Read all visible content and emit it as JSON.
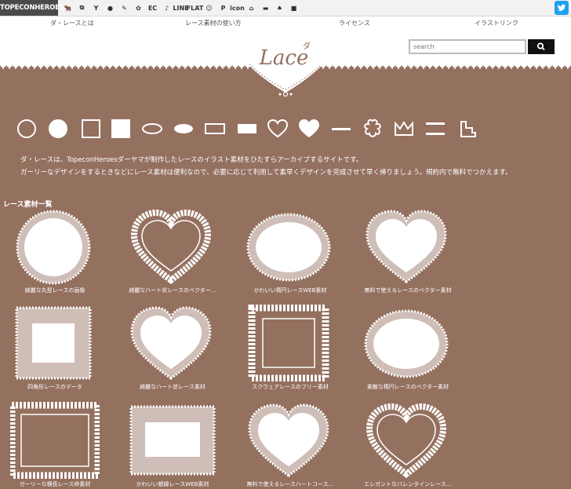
{
  "topbar": {
    "brand": "TOPECONHEROES",
    "icons": [
      {
        "name": "animal-icon",
        "glyph": "🐂"
      },
      {
        "name": "copy-icon",
        "glyph": "⧉"
      },
      {
        "name": "person-icon",
        "glyph": "Y"
      },
      {
        "name": "chat-icon",
        "glyph": "●"
      },
      {
        "name": "pen-icon",
        "glyph": "✎"
      },
      {
        "name": "flower-icon",
        "glyph": "✿"
      },
      {
        "name": "ec-icon",
        "glyph": "EC"
      },
      {
        "name": "music-icon",
        "glyph": "♪"
      },
      {
        "name": "line-icon",
        "glyph": "LINE"
      },
      {
        "name": "flat-icon",
        "glyph": "FLAT"
      },
      {
        "name": "smile-icon",
        "glyph": "☺"
      },
      {
        "name": "p-icon",
        "glyph": "P"
      },
      {
        "name": "icon-icon",
        "glyph": "icon"
      },
      {
        "name": "house-icon",
        "glyph": "⌂"
      },
      {
        "name": "car-icon",
        "glyph": "▬"
      },
      {
        "name": "chair-icon",
        "glyph": "♠"
      },
      {
        "name": "box-icon",
        "glyph": "■"
      }
    ]
  },
  "nav": {
    "items": [
      "ダ・レースとは",
      "レース素材の使い方",
      "ライセンス",
      "イラストリンク"
    ]
  },
  "logo": {
    "text": "Lace",
    "kana": "ダ"
  },
  "search": {
    "placeholder": "search"
  },
  "description": {
    "line1": "ダ・レースは、TopeconHeroesダーヤマが制作したレースのイラスト素材をひたすらアーカイブするサイトです。",
    "line2": "ガーリーなデザインをするときなどにレース素材は便利なので、必要に応じて利用して素早くデザインを完成させて早く帰りましょう。規約内で無料でつかえます。"
  },
  "section": {
    "title": "レース素材一覧"
  },
  "items": [
    {
      "caption": "綺麗な丸型レースの画像",
      "shape": "circle"
    },
    {
      "caption": "綺麗なハート状レースのベクター…",
      "shape": "heart-outline"
    },
    {
      "caption": "かわいい楕円レースWEB素材",
      "shape": "oval"
    },
    {
      "caption": "無料で使えるレースのベクター素材",
      "shape": "heart"
    },
    {
      "caption": "四角形レースのデータ",
      "shape": "square"
    },
    {
      "caption": "綺麗なハート状レース素材",
      "shape": "heart"
    },
    {
      "caption": "スクウェアレースのフリー素材",
      "shape": "square-frame"
    },
    {
      "caption": "素敵な楕円レースのベクター素材",
      "shape": "oval"
    },
    {
      "caption": "ガーリーな横長レース枠素材",
      "shape": "rect-wide"
    },
    {
      "caption": "かわいい額縁レースWEB素材",
      "shape": "rect-frame"
    },
    {
      "caption": "無料で使えるレースハートコース…",
      "shape": "heart"
    },
    {
      "caption": "エレガントなバレンタインレース…",
      "shape": "heart-outline"
    }
  ],
  "colors": {
    "background": "#94705f",
    "lace": "#ffffff",
    "search_button": "#111111",
    "twitter": "#1da1f2"
  }
}
